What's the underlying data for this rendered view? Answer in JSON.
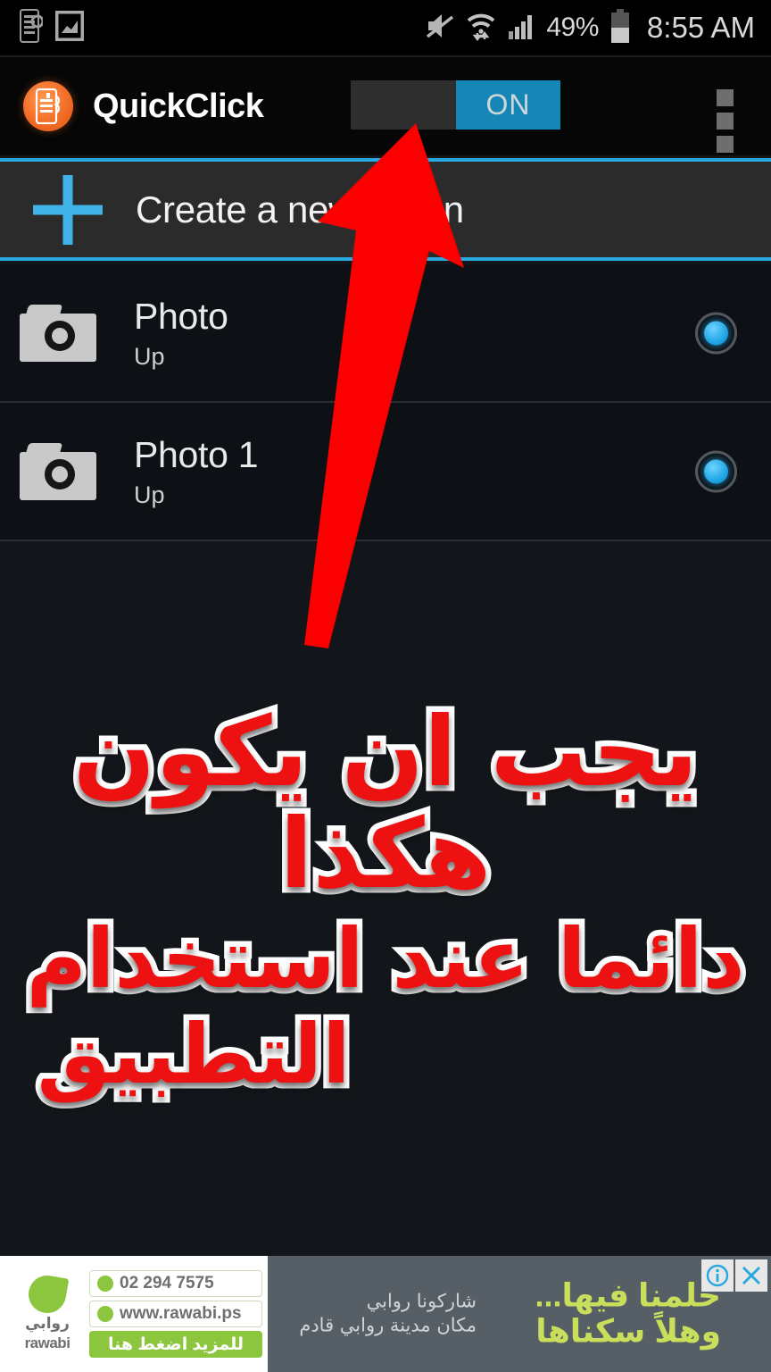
{
  "status_bar": {
    "notification_icons": [
      "phone-settings-icon",
      "picture-chart-icon"
    ],
    "mute_icon": "mute-icon",
    "wifi_icon": "wifi-transfer-icon",
    "signal_icon": "cellular-signal-icon",
    "battery_percent": "49%",
    "battery_icon": "battery-icon",
    "clock": "8:55 AM"
  },
  "app_bar": {
    "app_icon": "quickclick-app-icon",
    "title": "QuickClick",
    "switch_label": "ON",
    "switch_state": "on",
    "overflow_icon": "overflow-menu-icon"
  },
  "create_row": {
    "plus_icon": "plus-icon",
    "label": "Create a new action"
  },
  "actions": [
    {
      "icon": "camera-icon",
      "title": "Photo",
      "subtitle": "Up",
      "selected": true
    },
    {
      "icon": "camera-icon",
      "title": "Photo 1",
      "subtitle": "Up",
      "selected": true
    }
  ],
  "annotation": {
    "arrow": "red-up-arrow",
    "line1": "يجب ان يكون هكذا",
    "line2": "دائما عند استخدام",
    "line3": "التطبيق"
  },
  "ad": {
    "logo_arabic": "روابي",
    "logo_latin": "rawabi",
    "phone": "02 294 7575",
    "website": "www.rawabi.ps",
    "cta": "للمزيد اضغط هنا",
    "script_line": "مكان مدينة روابي قادم",
    "share_line": "شاركونا روابي",
    "headline1": "حلمنا فيها...",
    "headline2": "وهلاً سكناها",
    "info_icon": "info-icon",
    "close_icon": "close-icon"
  },
  "colors": {
    "accent_blue": "#29a8e0",
    "switch_on": "#1686b6",
    "brand_orange": "#f4712b",
    "annotation_red": "#ee1111",
    "ad_green": "#8cc63e",
    "background": "#121519"
  }
}
